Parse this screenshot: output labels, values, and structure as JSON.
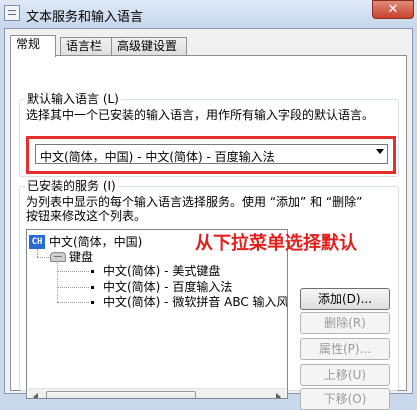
{
  "window": {
    "title": "文本服务和输入语言",
    "close_glyph": "✕"
  },
  "tabs": [
    {
      "label": "常规",
      "active": true
    },
    {
      "label": "语言栏",
      "active": false
    },
    {
      "label": "高级键设置",
      "active": false
    }
  ],
  "default_input": {
    "label": "默认输入语言 (L)",
    "description": "选择其中一个已安装的输入语言，用作所有输入字段的默认语言。",
    "selected": "中文(简体，中国) - 中文(简体) - 百度输入法"
  },
  "installed": {
    "label": "已安装的服务 (I)",
    "description_line1": "为列表中显示的每个输入语言选择服务。使用 “添加” 和 “删除”",
    "description_line2": "按钮来修改这个列表。",
    "language": {
      "icon_text": "CH",
      "label": "中文(简体，中国)"
    },
    "keyboard_label": "键盘",
    "services": [
      "中文(简体) - 美式键盘",
      "中文(简体) - 百度输入法",
      "中文(简体) - 微软拼音 ABC 输入风"
    ]
  },
  "buttons": {
    "add": "添加(D)...",
    "remove": "删除(R)",
    "properties": "属性(P)...",
    "move_up": "上移(U)",
    "move_down": "下移(O)"
  },
  "annotation": {
    "text": "从下拉菜单选择默认",
    "color": "#e0201f"
  }
}
